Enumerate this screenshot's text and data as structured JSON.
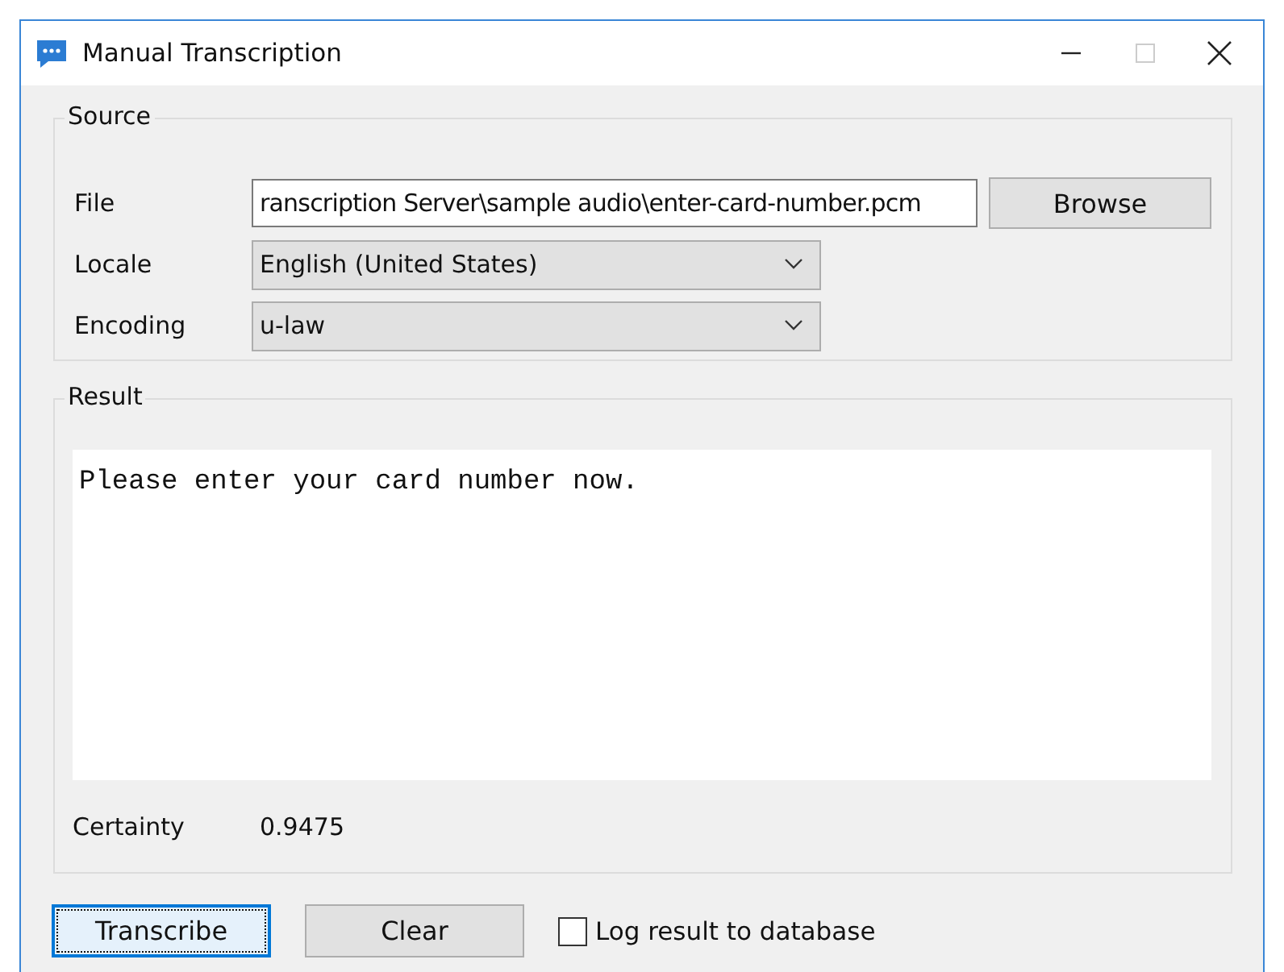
{
  "window": {
    "title": "Manual Transcription"
  },
  "source": {
    "legend": "Source",
    "file": {
      "label": "File",
      "value": "ranscription Server\\sample audio\\enter-card-number.pcm"
    },
    "browse_button": "Browse",
    "locale": {
      "label": "Locale",
      "value": "English (United States)"
    },
    "encoding": {
      "label": "Encoding",
      "value": "u-law"
    }
  },
  "result": {
    "legend": "Result",
    "text": "Please enter your card number now.",
    "certainty_label": "Certainty",
    "certainty_value": "0.9475"
  },
  "buttons": [
    {
      "label": "Transcribe",
      "focused": true
    },
    {
      "label": "Clear",
      "focused": false
    }
  ],
  "log_checkbox": {
    "label": "Log result to database",
    "checked": false
  }
}
